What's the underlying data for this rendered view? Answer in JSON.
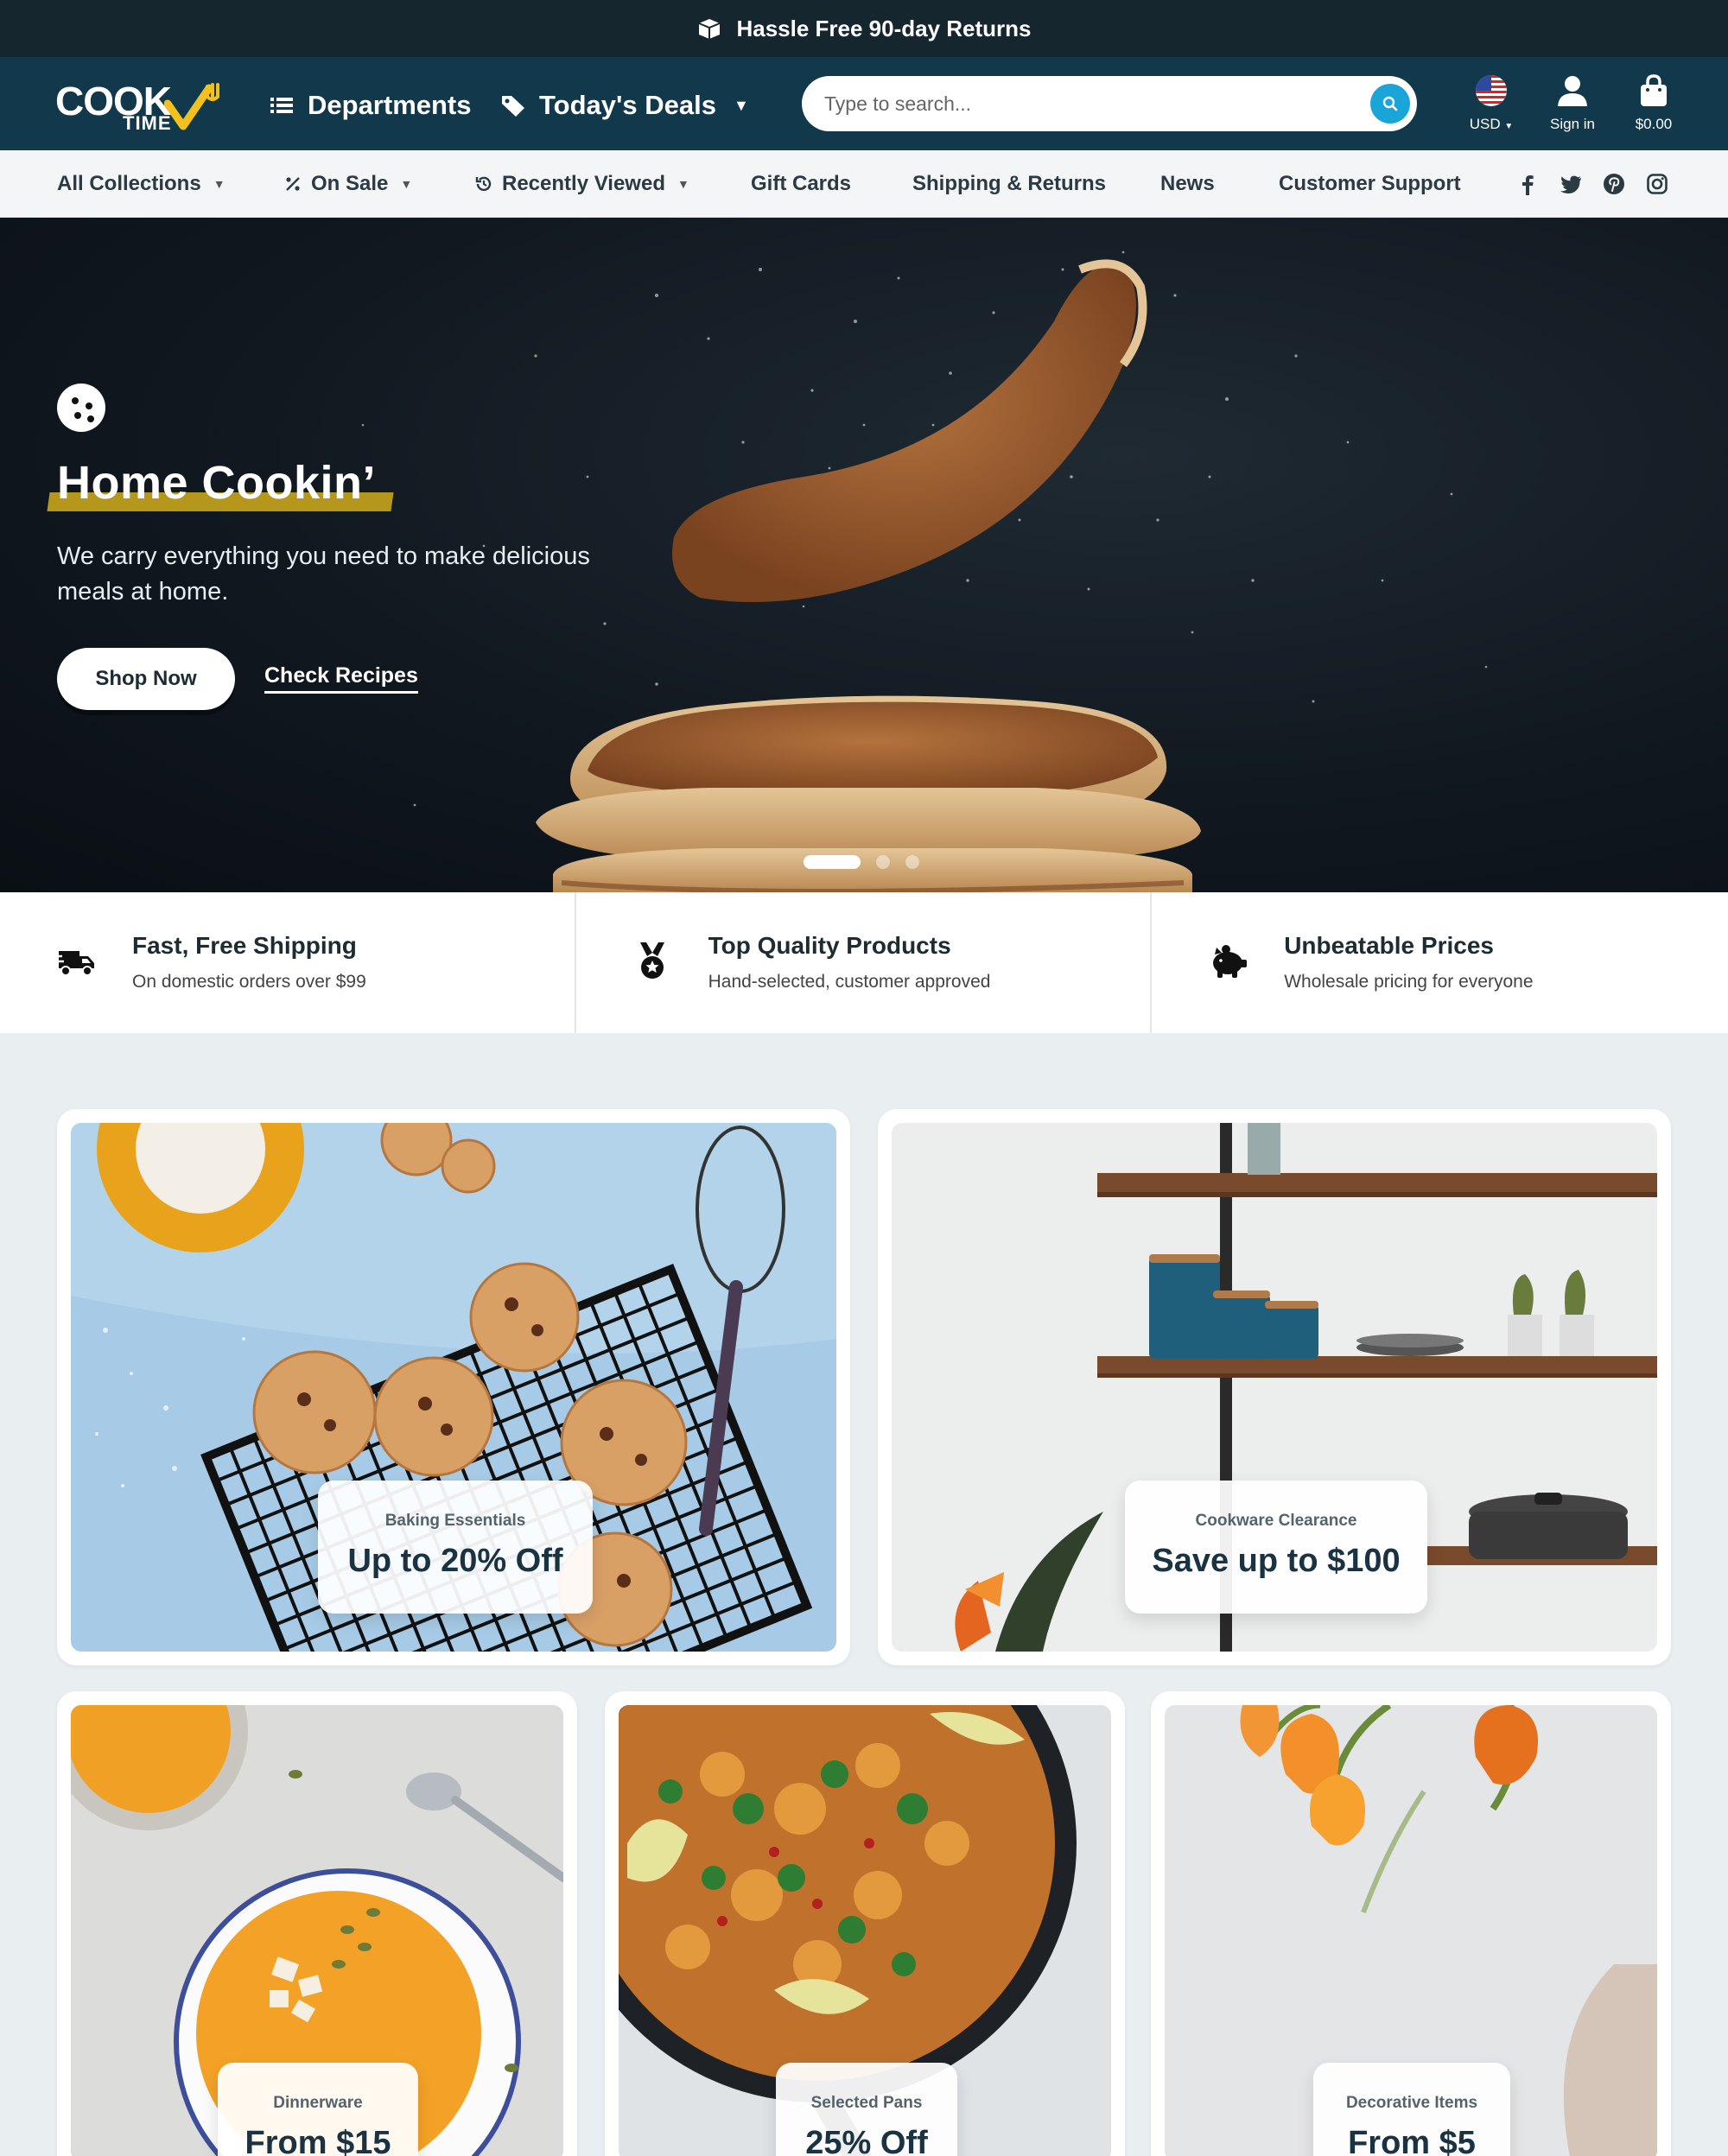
{
  "announcement": {
    "text": "Hassle Free 90-day Returns",
    "icon": "box-icon"
  },
  "header": {
    "logo": {
      "word1": "COOK",
      "word2": "TIME"
    },
    "departments_label": "Departments",
    "deals_label": "Today's Deals",
    "search_placeholder": "Type to search...",
    "currency_label": "USD",
    "signin_label": "Sign in",
    "cart_total": "$0.00"
  },
  "subnav": {
    "items": [
      {
        "label": "All Collections"
      },
      {
        "label": "On Sale"
      },
      {
        "label": "Recently Viewed"
      },
      {
        "label": "Gift Cards"
      },
      {
        "label": "Shipping & Returns"
      },
      {
        "label": "News"
      },
      {
        "label": "Customer Support"
      }
    ],
    "social": [
      "facebook-icon",
      "twitter-icon",
      "pinterest-icon",
      "instagram-icon"
    ]
  },
  "hero": {
    "title": "Home Cookin’",
    "text": "We carry everything you need to make delicious meals at home.",
    "primary_button": "Shop Now",
    "secondary_link": "Check Recipes",
    "slides_total": 3,
    "active_slide": 1
  },
  "features": [
    {
      "title": "Fast, Free Shipping",
      "subtitle": "On domestic orders over $99",
      "icon": "delivery-truck-icon"
    },
    {
      "title": "Top Quality Products",
      "subtitle": "Hand-selected, customer approved",
      "icon": "medal-icon"
    },
    {
      "title": "Unbeatable Prices",
      "subtitle": "Wholesale pricing for everyone",
      "icon": "piggy-bank-icon"
    }
  ],
  "promos": [
    {
      "category": "Baking Essentials",
      "offer": "Up to 20% Off"
    },
    {
      "category": "Cookware Clearance",
      "offer": "Save up to $100"
    },
    {
      "category": "Dinnerware",
      "offer": "From $15"
    },
    {
      "category": "Selected Pans",
      "offer": "25% Off"
    },
    {
      "category": "Decorative Items",
      "offer": "From $5"
    }
  ],
  "colors": {
    "header_bg": "#12394b",
    "announcement_bg": "#16262f",
    "accent_blue": "#1aa5d9",
    "highlight_yellow": "#c8a51c",
    "logo_yellow": "#f2c11d"
  }
}
